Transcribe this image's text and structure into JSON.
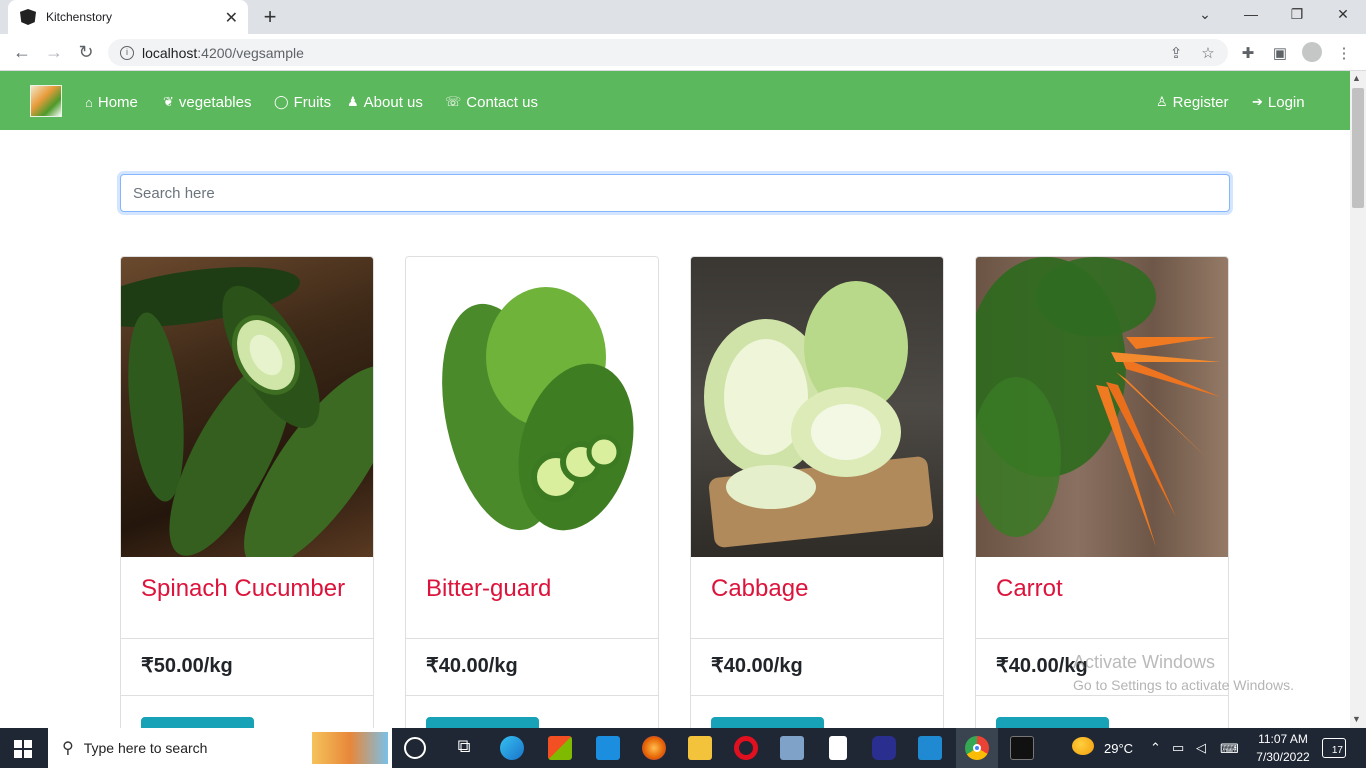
{
  "browser": {
    "tab_title": "Kitchenstory",
    "new_tab_label": "+",
    "url_host": "localhost",
    "url_path": ":4200/vegsample"
  },
  "navbar": {
    "links": [
      {
        "label": "Home",
        "icon": "home-icon"
      },
      {
        "label": "vegetables",
        "icon": "leaf-icon"
      },
      {
        "label": "Fruits",
        "icon": "lemon-icon"
      },
      {
        "label": "About us",
        "icon": "users-icon"
      },
      {
        "label": "Contact us",
        "icon": "phone-icon"
      }
    ],
    "right_links": [
      {
        "label": "Register",
        "icon": "user-plus-icon"
      },
      {
        "label": "Login",
        "icon": "sign-in-icon"
      }
    ]
  },
  "search": {
    "placeholder": "Search here"
  },
  "products": [
    {
      "name": "Spinach Cucumber",
      "price": "₹50.00/kg",
      "image": "cucumber-image"
    },
    {
      "name": "Bitter-guard",
      "price": "₹40.00/kg",
      "image": "bitter-gourd-image"
    },
    {
      "name": "Cabbage",
      "price": "₹40.00/kg",
      "image": "cabbage-image"
    },
    {
      "name": "Carrot",
      "price": "₹40.00/kg",
      "image": "carrot-image"
    }
  ],
  "watermark": {
    "line1": "Activate Windows",
    "line2": "Go to Settings to activate Windows."
  },
  "taskbar": {
    "search_placeholder": "Type here to search",
    "weather": "29°C",
    "time": "11:07 AM",
    "date": "7/30/2022",
    "notifications": "17"
  },
  "colors": {
    "navbar_bg": "#5cb85c",
    "product_name": "#dc143c",
    "button": "#17a2b8"
  }
}
